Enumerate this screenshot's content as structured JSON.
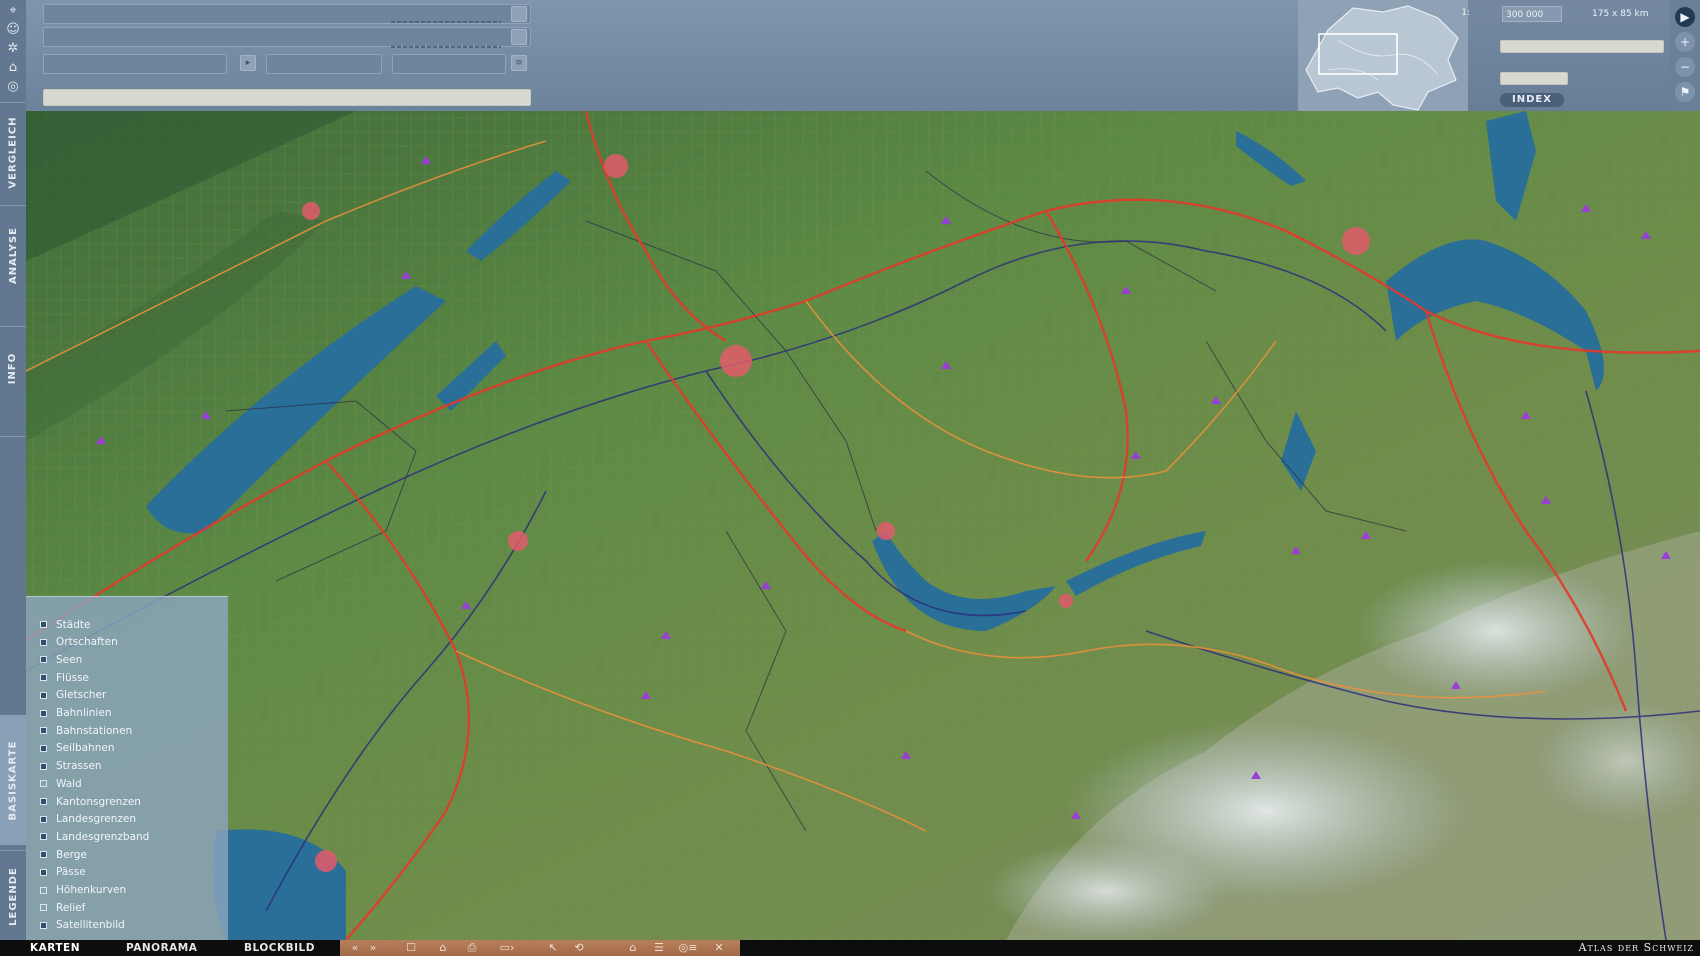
{
  "left_toolbar": {
    "tools": [
      {
        "icon": "map-pin-icon"
      },
      {
        "icon": "people-icon"
      },
      {
        "icon": "settings-icon"
      },
      {
        "icon": "building-icon"
      },
      {
        "icon": "layers-icon"
      }
    ],
    "vertical_tabs": [
      {
        "id": "vergleich",
        "label": "VERGLEICH"
      },
      {
        "id": "analyse",
        "label": "ANALYSE"
      },
      {
        "id": "info",
        "label": "INFO"
      },
      {
        "id": "basiskarte",
        "label": "BASISKARTE"
      },
      {
        "id": "legende",
        "label": "LEGENDE"
      }
    ]
  },
  "scale": {
    "prefix": "1:",
    "value": "300 000",
    "extent": "175 x 85 km"
  },
  "index_button": {
    "label": "INDEX"
  },
  "right_toolbar": {
    "tools": [
      {
        "icon": "play-icon"
      },
      {
        "icon": "zoom-in-icon"
      },
      {
        "icon": "zoom-out-icon"
      },
      {
        "icon": "flag-icon"
      }
    ]
  },
  "legend": {
    "items": [
      {
        "label": "Städte",
        "checked": true
      },
      {
        "label": "Ortschaften",
        "checked": true
      },
      {
        "label": "Seen",
        "checked": true
      },
      {
        "label": "Flüsse",
        "checked": true
      },
      {
        "label": "Gletscher",
        "checked": true
      },
      {
        "label": "Bahnlinien",
        "checked": true
      },
      {
        "label": "Bahnstationen",
        "checked": true
      },
      {
        "label": "Seilbahnen",
        "checked": true
      },
      {
        "label": "Strassen",
        "checked": true
      },
      {
        "label": "Wald",
        "checked": false
      },
      {
        "label": "Kantonsgrenzen",
        "checked": true
      },
      {
        "label": "Landesgrenzen",
        "checked": true
      },
      {
        "label": "Landesgrenzband",
        "checked": true
      },
      {
        "label": "Berge",
        "checked": true
      },
      {
        "label": "Pässe",
        "checked": true
      },
      {
        "label": "Höhenkurven",
        "checked": false
      },
      {
        "label": "Relief",
        "checked": false
      },
      {
        "label": "Satellitenbild",
        "checked": true
      }
    ]
  },
  "bottom_bar": {
    "tabs": [
      {
        "label": "KARTEN",
        "active": true
      },
      {
        "label": "PANORAMA",
        "active": false
      },
      {
        "label": "BLOCKBILD",
        "active": false
      }
    ],
    "nav_icons": [
      "prev-icon",
      "next-icon",
      "pointer-icon",
      "lock-icon",
      "print-icon",
      "measure-icon",
      "cursor-icon",
      "rotate-icon",
      "home-icon",
      "list-icon",
      "settings-icon",
      "close-icon"
    ],
    "brand": "Atlas der Schweiz"
  },
  "colors": {
    "header": "#7a90a8",
    "rail": "#627890",
    "lake": "#2a6f98",
    "road": "#e23a2a",
    "rail_line": "#2d2f7a",
    "glacier": "#dce8f2",
    "nav_strip": "#ab744f"
  }
}
